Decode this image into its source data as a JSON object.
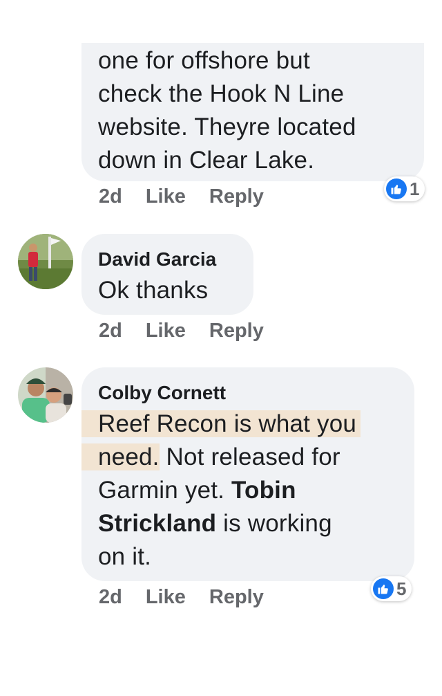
{
  "comments": [
    {
      "author": "",
      "text_lines": [
        "one for offshore but",
        "check the Hook N Line",
        "website. Theyre located",
        "down in Clear Lake."
      ],
      "time": "2d",
      "like_label": "Like",
      "reply_label": "Reply",
      "reaction_count": "1"
    },
    {
      "author": "David Garcia",
      "text": "Ok thanks",
      "time": "2d",
      "like_label": "Like",
      "reply_label": "Reply"
    },
    {
      "author": "Colby Cornett",
      "text_parts": {
        "hl1": "Reef Recon is what you",
        "hl2": "need.",
        "p1": " Not released for",
        "p2": "Garmin yet. ",
        "tag1": "Tobin",
        "tag2": "Strickland",
        "p3": " is working",
        "p4": "on it."
      },
      "time": "2d",
      "like_label": "Like",
      "reply_label": "Reply",
      "reaction_count": "5"
    }
  ],
  "colors": {
    "bubble": "#f0f2f5",
    "highlight": "#f2e4d2",
    "like_blue": "#1877f2",
    "meta_gray": "#65676b"
  }
}
